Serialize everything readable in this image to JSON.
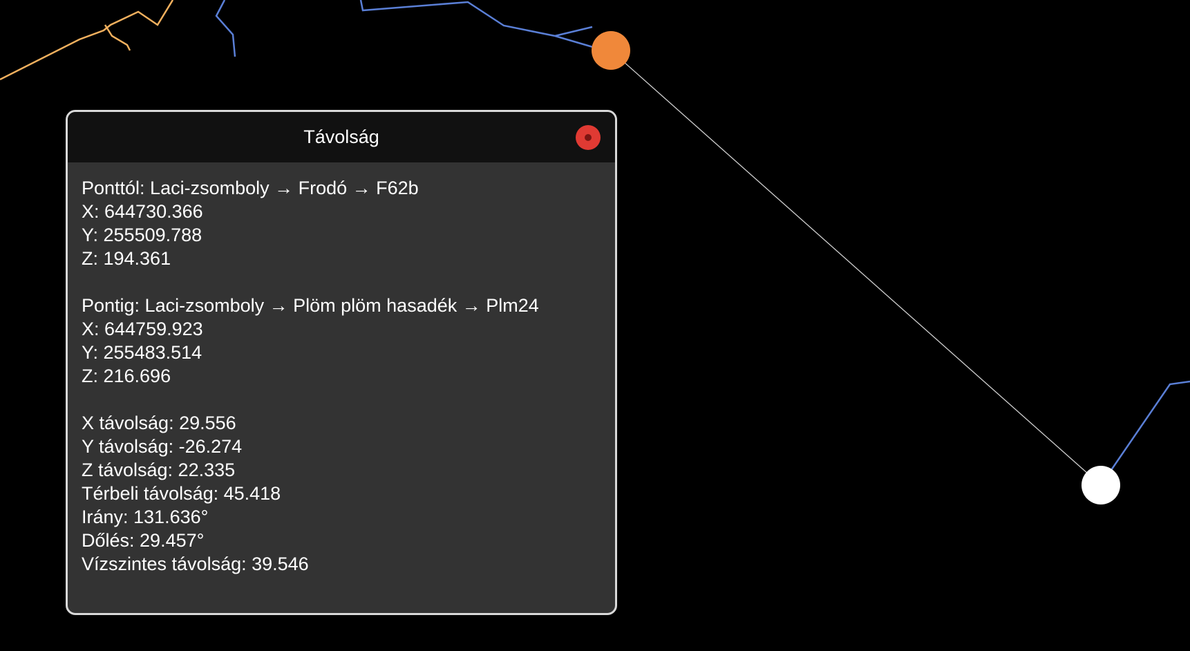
{
  "colors": {
    "background": "#000000",
    "panel_bg": "#333333",
    "panel_header_bg": "#111111",
    "panel_border": "#d9d9d9",
    "close_button": "#e03a33",
    "from_marker": "#f0883a",
    "to_marker": "#ffffff",
    "survey_blue": "#5a7fd6",
    "survey_orange": "#f2b05e",
    "measure_line": "#cfcfcf"
  },
  "dialog": {
    "title": "Távolság",
    "close_icon": "close-icon",
    "from": {
      "label": "Ponttól: Laci-zsomboly → Frodó → F62b",
      "x": "X: 644730.366",
      "y": "Y: 255509.788",
      "z": "Z: 194.361"
    },
    "to": {
      "label": "Pontig: Laci-zsomboly → Plöm plöm hasadék → Plm24",
      "x": "X: 644759.923",
      "y": "Y: 255483.514",
      "z": "Z: 216.696"
    },
    "results": {
      "dx": "X távolság: 29.556",
      "dy": "Y távolság: -26.274",
      "dz": "Z távolság: 22.335",
      "spatial": "Térbeli távolság: 45.418",
      "bearing": "Irány: 131.636°",
      "dip": "Dőlés: 29.457°",
      "horizontal": "Vízszintes távolság: 39.546"
    }
  }
}
